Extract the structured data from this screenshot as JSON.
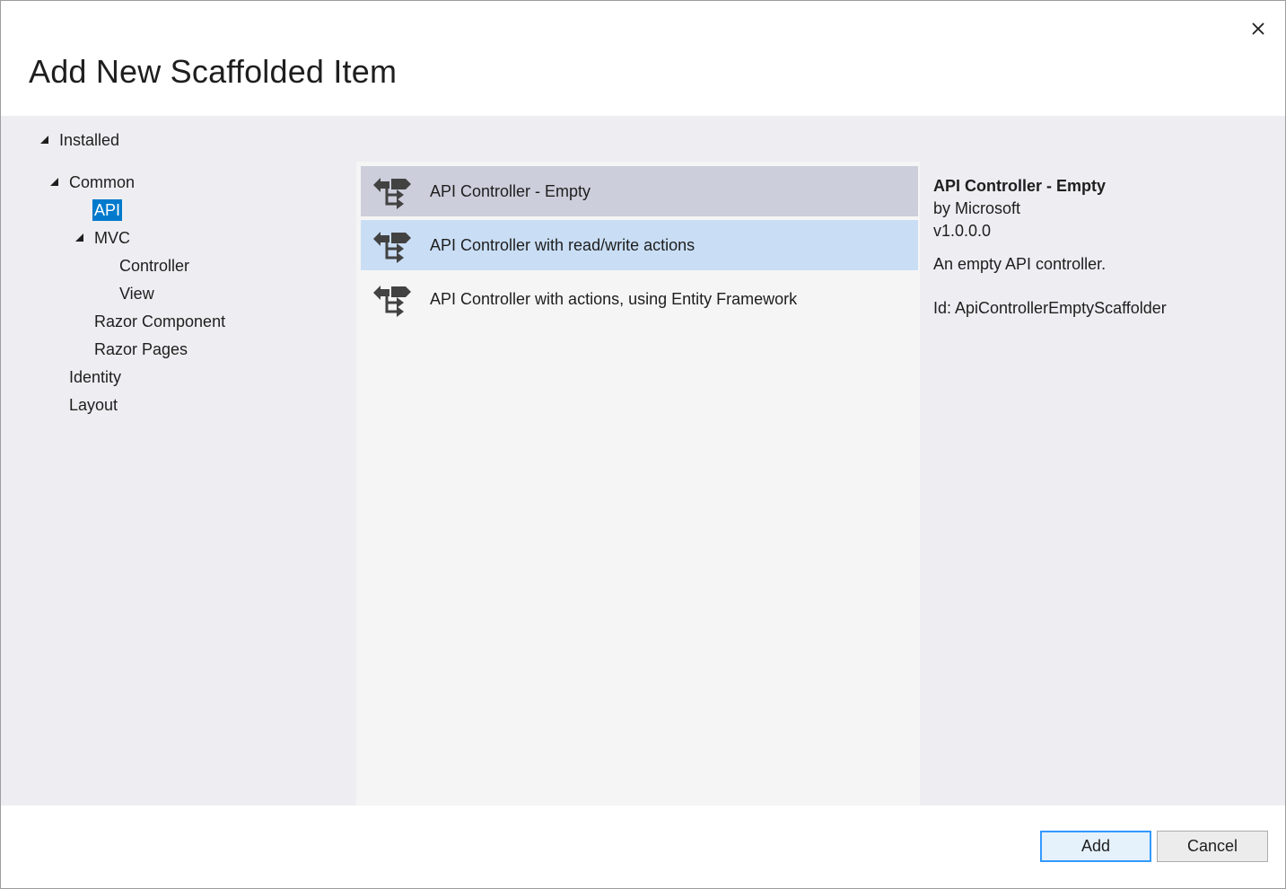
{
  "dialog": {
    "title": "Add New Scaffolded Item",
    "close_icon": "close-icon"
  },
  "tree": {
    "installed": "Installed",
    "common": "Common",
    "api": "API",
    "mvc": "MVC",
    "controller": "Controller",
    "view": "View",
    "razor_component": "Razor Component",
    "razor_pages": "Razor Pages",
    "identity": "Identity",
    "layout": "Layout"
  },
  "list": {
    "items": [
      {
        "label": "API Controller - Empty",
        "icon": "controller-icon",
        "state": "selected"
      },
      {
        "label": "API Controller with read/write actions",
        "icon": "controller-icon",
        "state": "hover"
      },
      {
        "label": "API Controller with actions, using Entity Framework",
        "icon": "controller-icon",
        "state": "normal"
      }
    ]
  },
  "details": {
    "title": "API Controller - Empty",
    "author": "by Microsoft",
    "version": "v1.0.0.0",
    "description": "An empty API controller.",
    "id": "Id: ApiControllerEmptyScaffolder"
  },
  "footer": {
    "add_label": "Add",
    "cancel_label": "Cancel"
  },
  "colors": {
    "tree_selected": "#007acc",
    "list_selected": "#cccedb",
    "list_hover": "#c9def5",
    "body_background": "#eeeef2",
    "primary_border": "#3399ff"
  }
}
